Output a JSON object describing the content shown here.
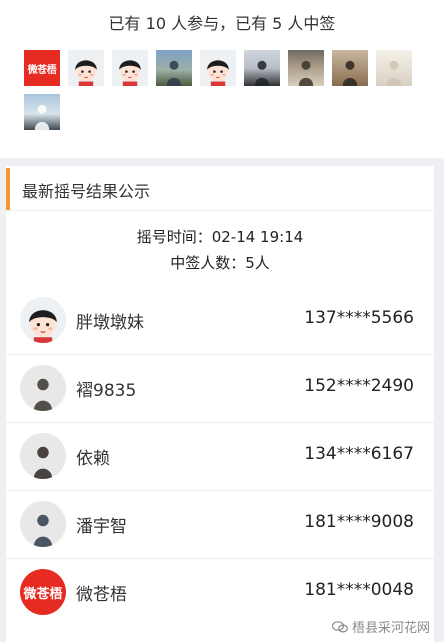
{
  "summary": {
    "text": "已有 10 人参与，已有 5 人中签"
  },
  "participants": [
    {
      "kind": "brand",
      "label": "微苍梧",
      "icon": "brand-logo"
    },
    {
      "kind": "face",
      "icon": "cartoon-boy-avatar"
    },
    {
      "kind": "face",
      "icon": "cartoon-boy-avatar"
    },
    {
      "kind": "photo1",
      "icon": "photo-avatar"
    },
    {
      "kind": "face",
      "icon": "cartoon-boy-avatar"
    },
    {
      "kind": "photo2",
      "icon": "photo-avatar"
    },
    {
      "kind": "photo3",
      "icon": "photo-avatar"
    },
    {
      "kind": "photo5",
      "icon": "photo-avatar"
    },
    {
      "kind": "photo4",
      "icon": "photo-avatar"
    },
    {
      "kind": "photo6",
      "icon": "photo-avatar"
    }
  ],
  "panel": {
    "title": "最新摇号结果公示",
    "accent": "#f29a2e",
    "draw_time": "摇号时间：02-14 19:14",
    "winner_count": "中签人数：5人"
  },
  "winners": [
    {
      "name": "胖墩墩妹",
      "phone": "137****5566",
      "avatar": "face",
      "icon": "cartoon-boy-avatar"
    },
    {
      "name": "褶9835",
      "phone": "152****2490",
      "avatar": "photo3",
      "icon": "photo-avatar"
    },
    {
      "name": "依赖",
      "phone": "134****6167",
      "avatar": "photo5",
      "icon": "photo-avatar"
    },
    {
      "name": "潘宇智",
      "phone": "181****9008",
      "avatar": "photo1",
      "icon": "photo-avatar"
    },
    {
      "name": "微苍梧",
      "phone": "181****0048",
      "avatar": "brand",
      "label": "微苍梧",
      "icon": "brand-logo"
    }
  ],
  "watermark": {
    "text": "梧县采河花网",
    "icon": "wechat-icon"
  },
  "colors": {
    "brand_red": "#e62b23",
    "accent_orange": "#f29a2e",
    "background": "#efeff4"
  }
}
